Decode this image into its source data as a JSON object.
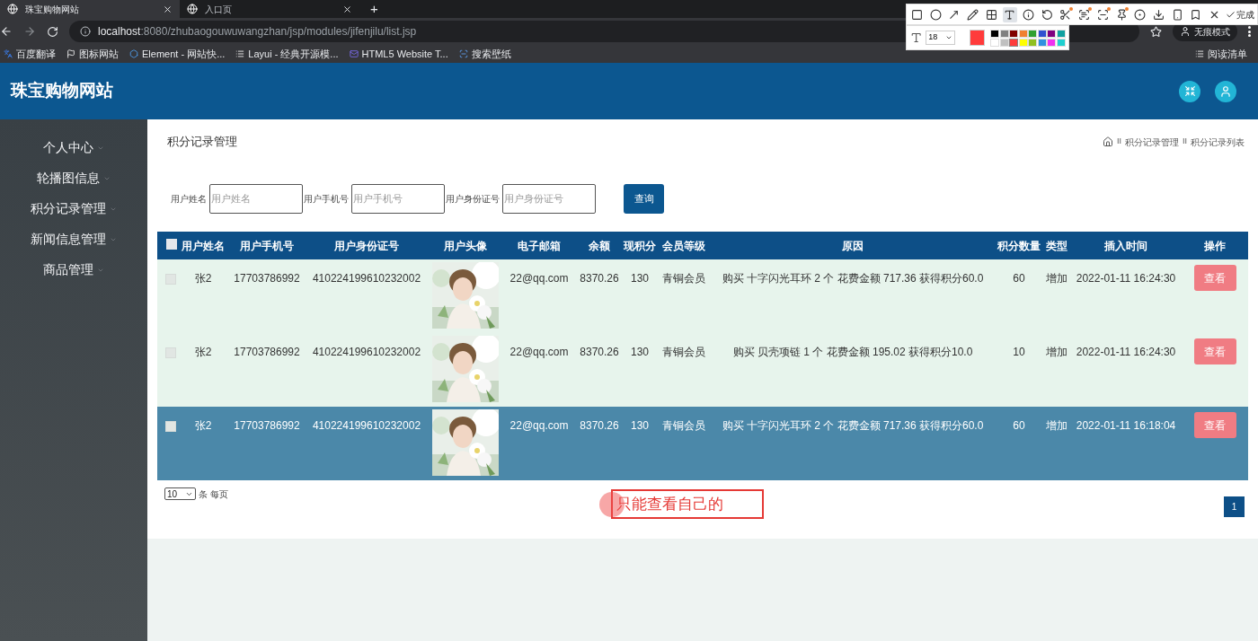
{
  "browser": {
    "tabs": [
      {
        "title": "珠宝购物网站",
        "selected": true
      },
      {
        "title": "入口页",
        "selected": false
      }
    ],
    "new_tab": "+",
    "url_host": "localhost",
    "url_rest": ":8080/zhubaogouwuwangzhan/jsp/modules/jifenjilu/list.jsp",
    "incognito": "无痕模式",
    "bookmarks": [
      {
        "title": "百度翻译",
        "kind": "translate"
      },
      {
        "title": "图标网站",
        "kind": "flag"
      },
      {
        "title": "Element - 网站快...",
        "kind": "hex"
      },
      {
        "title": "Layui - 经典开源模...",
        "kind": "bars"
      },
      {
        "title": "HTML5 Website T...",
        "kind": "mail"
      },
      {
        "title": "搜索壁纸",
        "kind": "u"
      }
    ],
    "reading_list": "阅读清单"
  },
  "capture_toolbar": {
    "tools": [
      {
        "kind": "rect",
        "selected": false,
        "dot": false
      },
      {
        "kind": "ellipse",
        "selected": false,
        "dot": false
      },
      {
        "kind": "arrow",
        "selected": false,
        "dot": false
      },
      {
        "kind": "pencil",
        "selected": false,
        "dot": false
      },
      {
        "kind": "mosaic",
        "selected": false,
        "dot": false
      },
      {
        "kind": "text",
        "selected": true,
        "dot": false
      },
      {
        "kind": "number",
        "selected": false,
        "dot": false
      },
      {
        "kind": "undo",
        "selected": false,
        "dot": false
      },
      {
        "kind": "scissors",
        "selected": false,
        "dot": true
      },
      {
        "kind": "ocr",
        "selected": false,
        "dot": true
      },
      {
        "kind": "scan",
        "selected": false,
        "dot": true
      },
      {
        "kind": "pin",
        "selected": false,
        "dot": true
      },
      {
        "kind": "record",
        "selected": false,
        "dot": false
      },
      {
        "kind": "download",
        "selected": false,
        "dot": false
      },
      {
        "kind": "phone",
        "selected": false,
        "dot": false
      },
      {
        "kind": "bookmark",
        "selected": false,
        "dot": false
      },
      {
        "kind": "close",
        "selected": false,
        "dot": false
      }
    ],
    "done": "完成",
    "font_size": "18",
    "palette": [
      {
        "color": "#000000",
        "selected": false
      },
      {
        "color": "#808080",
        "selected": false
      },
      {
        "color": "#800000",
        "selected": false
      },
      {
        "color": "#f08030",
        "selected": false
      },
      {
        "color": "#30a030",
        "selected": false
      },
      {
        "color": "#3050d0",
        "selected": false
      },
      {
        "color": "#800080",
        "selected": false
      },
      {
        "color": "#10a0a0",
        "selected": false
      },
      {
        "color": "#ffffff",
        "selected": false
      },
      {
        "color": "#c0c0c0",
        "selected": false
      },
      {
        "color": "#ff3b3b",
        "selected": true
      },
      {
        "color": "#ffff00",
        "selected": false
      },
      {
        "color": "#90c020",
        "selected": false
      },
      {
        "color": "#3090e0",
        "selected": false
      },
      {
        "color": "#f030f0",
        "selected": false
      },
      {
        "color": "#20d0d0",
        "selected": false
      }
    ]
  },
  "header": {
    "site_title": "珠宝购物网站"
  },
  "sidebar": {
    "items": [
      "个人中心",
      "轮播图信息",
      "积分记录管理",
      "新闻信息管理",
      "商品管理"
    ]
  },
  "page": {
    "title": "积分记录管理",
    "breadcrumb": [
      {
        "separator": "II",
        "label": "积分记录管理"
      },
      {
        "separator": "II",
        "label": "积分记录列表"
      }
    ],
    "search_fields": [
      {
        "label": "用户姓名",
        "placeholder": "用户姓名"
      },
      {
        "label": "用户手机号",
        "placeholder": "用户手机号"
      },
      {
        "label": "用户身份证号",
        "placeholder": "用户身份证号"
      }
    ],
    "search_button": "查询"
  },
  "table": {
    "header_checked": false,
    "columns": [
      "用户姓名",
      "用户手机号",
      "用户身份证号",
      "用户头像",
      "电子邮箱",
      "余额",
      "现积分",
      "会员等级",
      "原因",
      "积分数量",
      "类型",
      "插入时间",
      "操作"
    ],
    "rows": [
      {
        "selected": false,
        "checked": false,
        "cells": [
          "张2",
          "17703786992",
          "410224199610232002",
          {
            "kind": "picture"
          },
          "22@qq.com",
          "8370.26",
          "130",
          "青铜会员",
          "购买 十字闪光耳环 2 个 花费金额 717.36 获得积分60.0",
          "60",
          "增加",
          "2022-01-11 16:24:30"
        ],
        "action": "查看"
      },
      {
        "selected": false,
        "checked": false,
        "cells": [
          "张2",
          "17703786992",
          "410224199610232002",
          {
            "kind": "picture"
          },
          "22@qq.com",
          "8370.26",
          "130",
          "青铜会员",
          "购买 贝壳项链 1 个 花费金额 195.02 获得积分10.0",
          "10",
          "增加",
          "2022-01-11 16:24:30"
        ],
        "action": "查看"
      },
      {
        "selected": true,
        "checked": false,
        "cells": [
          "张2",
          "17703786992",
          "410224199610232002",
          {
            "kind": "picture"
          },
          "22@qq.com",
          "8370.26",
          "130",
          "青铜会员",
          "购买 十字闪光耳环 2 个 花费金额 717.36 获得积分60.0",
          "60",
          "增加",
          "2022-01-11 16:18:04"
        ],
        "action": "查看"
      }
    ]
  },
  "footer": {
    "page_size": "10",
    "page_size_suffix": "条 每页",
    "pages": [
      {
        "label": "1",
        "selected": true
      }
    ]
  },
  "annotation": {
    "text": "只能查看自己的"
  }
}
